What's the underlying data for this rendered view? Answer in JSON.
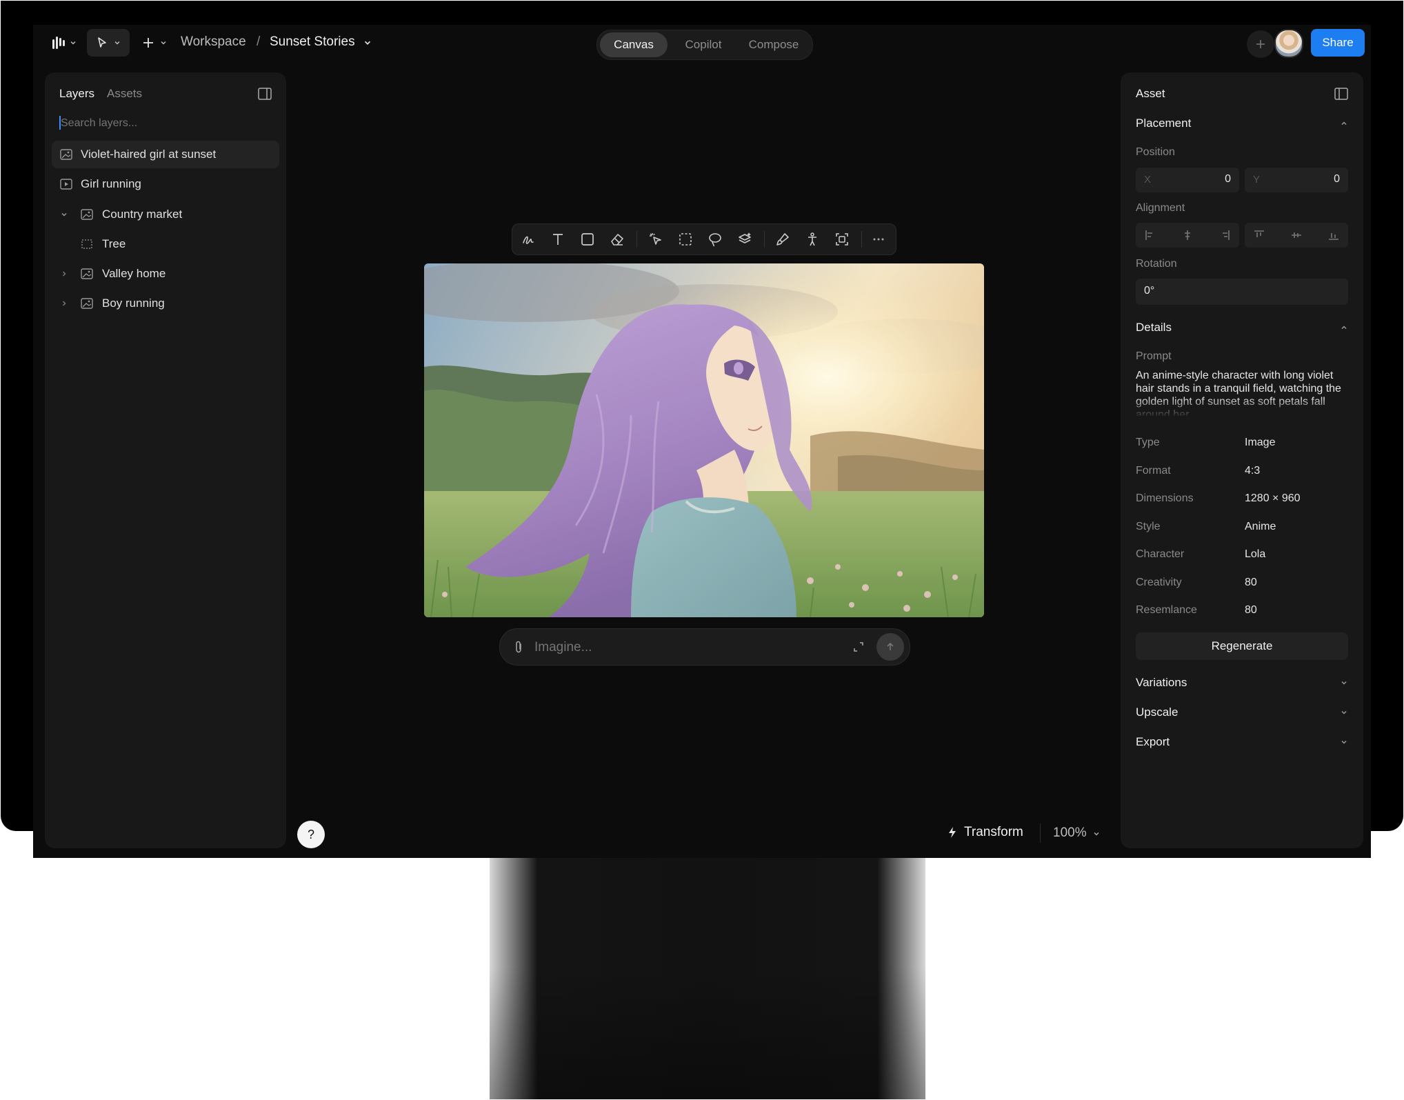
{
  "topbar": {
    "breadcrumb_workspace": "Workspace",
    "breadcrumb_separator": "/",
    "breadcrumb_project": "Sunset Stories",
    "tabs": [
      {
        "label": "Canvas",
        "active": true
      },
      {
        "label": "Copilot",
        "active": false
      },
      {
        "label": "Compose",
        "active": false
      }
    ],
    "share_label": "Share"
  },
  "left_panel": {
    "tabs": [
      "Layers",
      "Assets"
    ],
    "search_placeholder": "Search layers...",
    "layers": [
      {
        "label": "Violet-haired girl at sunset",
        "icon": "image-icon",
        "selected": true
      },
      {
        "label": "Girl running",
        "icon": "video-icon"
      },
      {
        "label": "Country market",
        "icon": "image-icon",
        "expanded": true
      },
      {
        "label": "Tree",
        "icon": "frame-icon",
        "child": true
      },
      {
        "label": "Valley home",
        "icon": "image-icon",
        "collapsed": true
      },
      {
        "label": "Boy running",
        "icon": "image-icon",
        "collapsed": true
      }
    ]
  },
  "canvas": {
    "prompt_placeholder": "Imagine...",
    "help_label": "?",
    "transform_label": "Transform",
    "zoom_label": "100%"
  },
  "right_panel": {
    "title": "Asset",
    "placement": {
      "title": "Placement",
      "position_label": "Position",
      "x_label": "X",
      "x_value": "0",
      "y_label": "Y",
      "y_value": "0",
      "alignment_label": "Alignment",
      "rotation_label": "Rotation",
      "rotation_value": "0°"
    },
    "details": {
      "title": "Details",
      "prompt_label": "Prompt",
      "prompt_text": "An anime-style character with long violet hair stands in a tranquil field, watching the golden light of sunset as soft petals fall around her.",
      "rows": [
        {
          "key": "Type",
          "value": "Image"
        },
        {
          "key": "Format",
          "value": "4:3"
        },
        {
          "key": "Dimensions",
          "value": "1280 × 960"
        },
        {
          "key": "Style",
          "value": "Anime"
        },
        {
          "key": "Character",
          "value": "Lola"
        },
        {
          "key": "Creativity",
          "value": "80"
        },
        {
          "key": "Resemlance",
          "value": "80"
        }
      ],
      "regenerate_label": "Regenerate"
    },
    "sections": [
      "Variations",
      "Upscale",
      "Export"
    ]
  },
  "colors": {
    "accent": "#1d7ef2",
    "app_bg": "#0c0c0c",
    "panel_bg": "#181818"
  }
}
